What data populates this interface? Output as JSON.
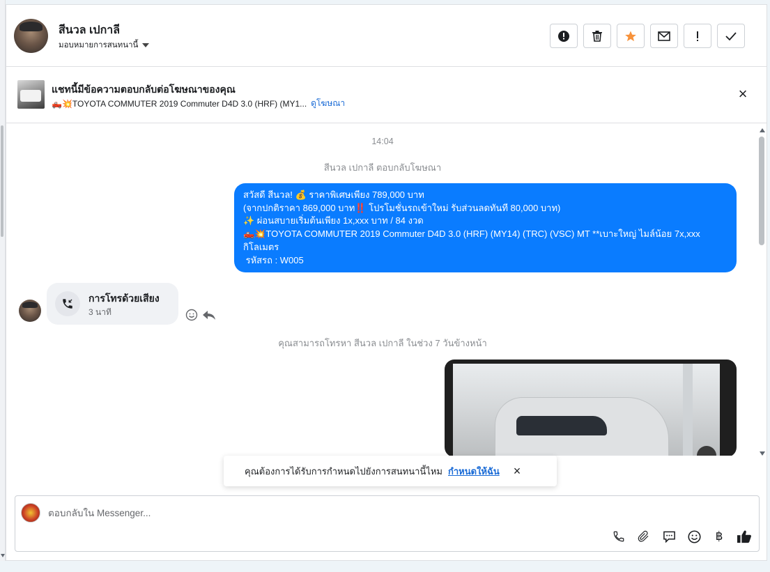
{
  "header": {
    "contact_name": "สีนวล เปกาลี",
    "assign_label": "มอบหมายการสนทนานี้",
    "actions": [
      {
        "name": "report-button",
        "icon": "alert-circle-icon",
        "glyph": "!"
      },
      {
        "name": "delete-button",
        "icon": "trash-icon",
        "glyph": "🗑"
      },
      {
        "name": "star-button",
        "icon": "star-icon",
        "glyph": "★"
      },
      {
        "name": "mark-unread-button",
        "icon": "envelope-icon",
        "glyph": "✉"
      },
      {
        "name": "spam-button",
        "icon": "exclamation-icon",
        "glyph": "!"
      },
      {
        "name": "mark-done-button",
        "icon": "check-icon",
        "glyph": "✓"
      }
    ]
  },
  "ad_banner": {
    "title": "แชทนี้มีข้อความตอบกลับต่อโฆษณาของคุณ",
    "subtitle": "🛻💥TOYOTA COMMUTER 2019 Commuter D4D 3.0 (HRF) (MY1...",
    "link": "ดูโฆษณา"
  },
  "conversation": {
    "time": "14:04",
    "ad_reply_note": "สีนวล เปกาลี ตอบกลับโฆษณา",
    "outgoing_lines": [
      "สวัสดี สีนวล! 💰 ราคาพิเศษเพียง 789,000 บาท",
      "(จากปกติราคา 869,000 บาท‼️ โปรโมชั่นรถเข้าใหม่ รับส่วนลดทันที 80,000 บาท)",
      "✨ ผ่อนสบายเริ่มต้นเพียง 1x,xxx บาท / 84 งวด",
      "🛻💥TOYOTA COMMUTER 2019 Commuter D4D 3.0 (HRF) (MY14) (TRC) (VSC) MT **เบาะใหญ่ ไมล์น้อย 7x,xxx",
      "กิโลเมตร",
      " รหัสรถ : W005"
    ],
    "call": {
      "title": "การโทรด้วยเสียง",
      "duration": "3 นาที"
    },
    "call_note": "คุณสามารถโทรหา สีนวล เปกาลี ในช่วง 7 วันข้างหน้า"
  },
  "toast": {
    "text": "คุณต้องการได้รับการกำหนดไปยังการสนทนานี้ไหม",
    "link": "กำหนดให้ฉัน"
  },
  "composer": {
    "placeholder": "ตอบกลับใน Messenger...",
    "tools": [
      {
        "name": "phone-icon"
      },
      {
        "name": "paperclip-icon"
      },
      {
        "name": "saved-reply-icon"
      },
      {
        "name": "emoji-icon"
      },
      {
        "name": "baht-icon",
        "glyph": "฿"
      },
      {
        "name": "thumbs-up-icon"
      }
    ]
  },
  "colors": {
    "outgoing_bubble": "#0a7cff",
    "link": "#1a6bd6",
    "star": "#f7923b"
  }
}
